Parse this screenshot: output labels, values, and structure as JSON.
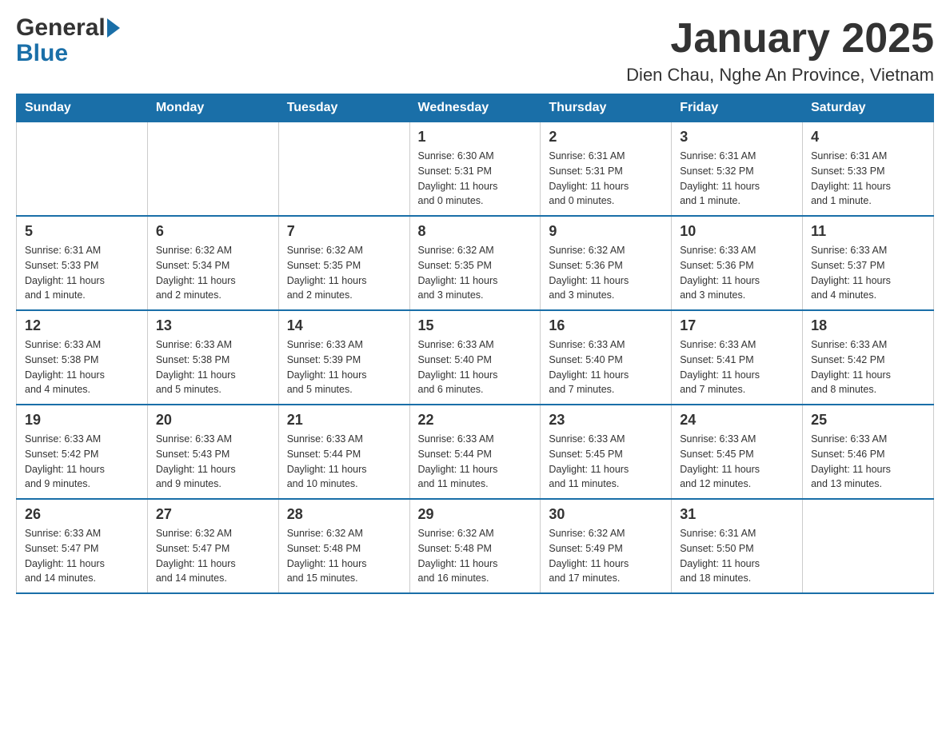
{
  "header": {
    "logo_general": "General",
    "logo_blue": "Blue",
    "title": "January 2025",
    "subtitle": "Dien Chau, Nghe An Province, Vietnam"
  },
  "days": [
    "Sunday",
    "Monday",
    "Tuesday",
    "Wednesday",
    "Thursday",
    "Friday",
    "Saturday"
  ],
  "weeks": [
    [
      {
        "day": "",
        "info": ""
      },
      {
        "day": "",
        "info": ""
      },
      {
        "day": "",
        "info": ""
      },
      {
        "day": "1",
        "info": "Sunrise: 6:30 AM\nSunset: 5:31 PM\nDaylight: 11 hours\nand 0 minutes."
      },
      {
        "day": "2",
        "info": "Sunrise: 6:31 AM\nSunset: 5:31 PM\nDaylight: 11 hours\nand 0 minutes."
      },
      {
        "day": "3",
        "info": "Sunrise: 6:31 AM\nSunset: 5:32 PM\nDaylight: 11 hours\nand 1 minute."
      },
      {
        "day": "4",
        "info": "Sunrise: 6:31 AM\nSunset: 5:33 PM\nDaylight: 11 hours\nand 1 minute."
      }
    ],
    [
      {
        "day": "5",
        "info": "Sunrise: 6:31 AM\nSunset: 5:33 PM\nDaylight: 11 hours\nand 1 minute."
      },
      {
        "day": "6",
        "info": "Sunrise: 6:32 AM\nSunset: 5:34 PM\nDaylight: 11 hours\nand 2 minutes."
      },
      {
        "day": "7",
        "info": "Sunrise: 6:32 AM\nSunset: 5:35 PM\nDaylight: 11 hours\nand 2 minutes."
      },
      {
        "day": "8",
        "info": "Sunrise: 6:32 AM\nSunset: 5:35 PM\nDaylight: 11 hours\nand 3 minutes."
      },
      {
        "day": "9",
        "info": "Sunrise: 6:32 AM\nSunset: 5:36 PM\nDaylight: 11 hours\nand 3 minutes."
      },
      {
        "day": "10",
        "info": "Sunrise: 6:33 AM\nSunset: 5:36 PM\nDaylight: 11 hours\nand 3 minutes."
      },
      {
        "day": "11",
        "info": "Sunrise: 6:33 AM\nSunset: 5:37 PM\nDaylight: 11 hours\nand 4 minutes."
      }
    ],
    [
      {
        "day": "12",
        "info": "Sunrise: 6:33 AM\nSunset: 5:38 PM\nDaylight: 11 hours\nand 4 minutes."
      },
      {
        "day": "13",
        "info": "Sunrise: 6:33 AM\nSunset: 5:38 PM\nDaylight: 11 hours\nand 5 minutes."
      },
      {
        "day": "14",
        "info": "Sunrise: 6:33 AM\nSunset: 5:39 PM\nDaylight: 11 hours\nand 5 minutes."
      },
      {
        "day": "15",
        "info": "Sunrise: 6:33 AM\nSunset: 5:40 PM\nDaylight: 11 hours\nand 6 minutes."
      },
      {
        "day": "16",
        "info": "Sunrise: 6:33 AM\nSunset: 5:40 PM\nDaylight: 11 hours\nand 7 minutes."
      },
      {
        "day": "17",
        "info": "Sunrise: 6:33 AM\nSunset: 5:41 PM\nDaylight: 11 hours\nand 7 minutes."
      },
      {
        "day": "18",
        "info": "Sunrise: 6:33 AM\nSunset: 5:42 PM\nDaylight: 11 hours\nand 8 minutes."
      }
    ],
    [
      {
        "day": "19",
        "info": "Sunrise: 6:33 AM\nSunset: 5:42 PM\nDaylight: 11 hours\nand 9 minutes."
      },
      {
        "day": "20",
        "info": "Sunrise: 6:33 AM\nSunset: 5:43 PM\nDaylight: 11 hours\nand 9 minutes."
      },
      {
        "day": "21",
        "info": "Sunrise: 6:33 AM\nSunset: 5:44 PM\nDaylight: 11 hours\nand 10 minutes."
      },
      {
        "day": "22",
        "info": "Sunrise: 6:33 AM\nSunset: 5:44 PM\nDaylight: 11 hours\nand 11 minutes."
      },
      {
        "day": "23",
        "info": "Sunrise: 6:33 AM\nSunset: 5:45 PM\nDaylight: 11 hours\nand 11 minutes."
      },
      {
        "day": "24",
        "info": "Sunrise: 6:33 AM\nSunset: 5:45 PM\nDaylight: 11 hours\nand 12 minutes."
      },
      {
        "day": "25",
        "info": "Sunrise: 6:33 AM\nSunset: 5:46 PM\nDaylight: 11 hours\nand 13 minutes."
      }
    ],
    [
      {
        "day": "26",
        "info": "Sunrise: 6:33 AM\nSunset: 5:47 PM\nDaylight: 11 hours\nand 14 minutes."
      },
      {
        "day": "27",
        "info": "Sunrise: 6:32 AM\nSunset: 5:47 PM\nDaylight: 11 hours\nand 14 minutes."
      },
      {
        "day": "28",
        "info": "Sunrise: 6:32 AM\nSunset: 5:48 PM\nDaylight: 11 hours\nand 15 minutes."
      },
      {
        "day": "29",
        "info": "Sunrise: 6:32 AM\nSunset: 5:48 PM\nDaylight: 11 hours\nand 16 minutes."
      },
      {
        "day": "30",
        "info": "Sunrise: 6:32 AM\nSunset: 5:49 PM\nDaylight: 11 hours\nand 17 minutes."
      },
      {
        "day": "31",
        "info": "Sunrise: 6:31 AM\nSunset: 5:50 PM\nDaylight: 11 hours\nand 18 minutes."
      },
      {
        "day": "",
        "info": ""
      }
    ]
  ]
}
